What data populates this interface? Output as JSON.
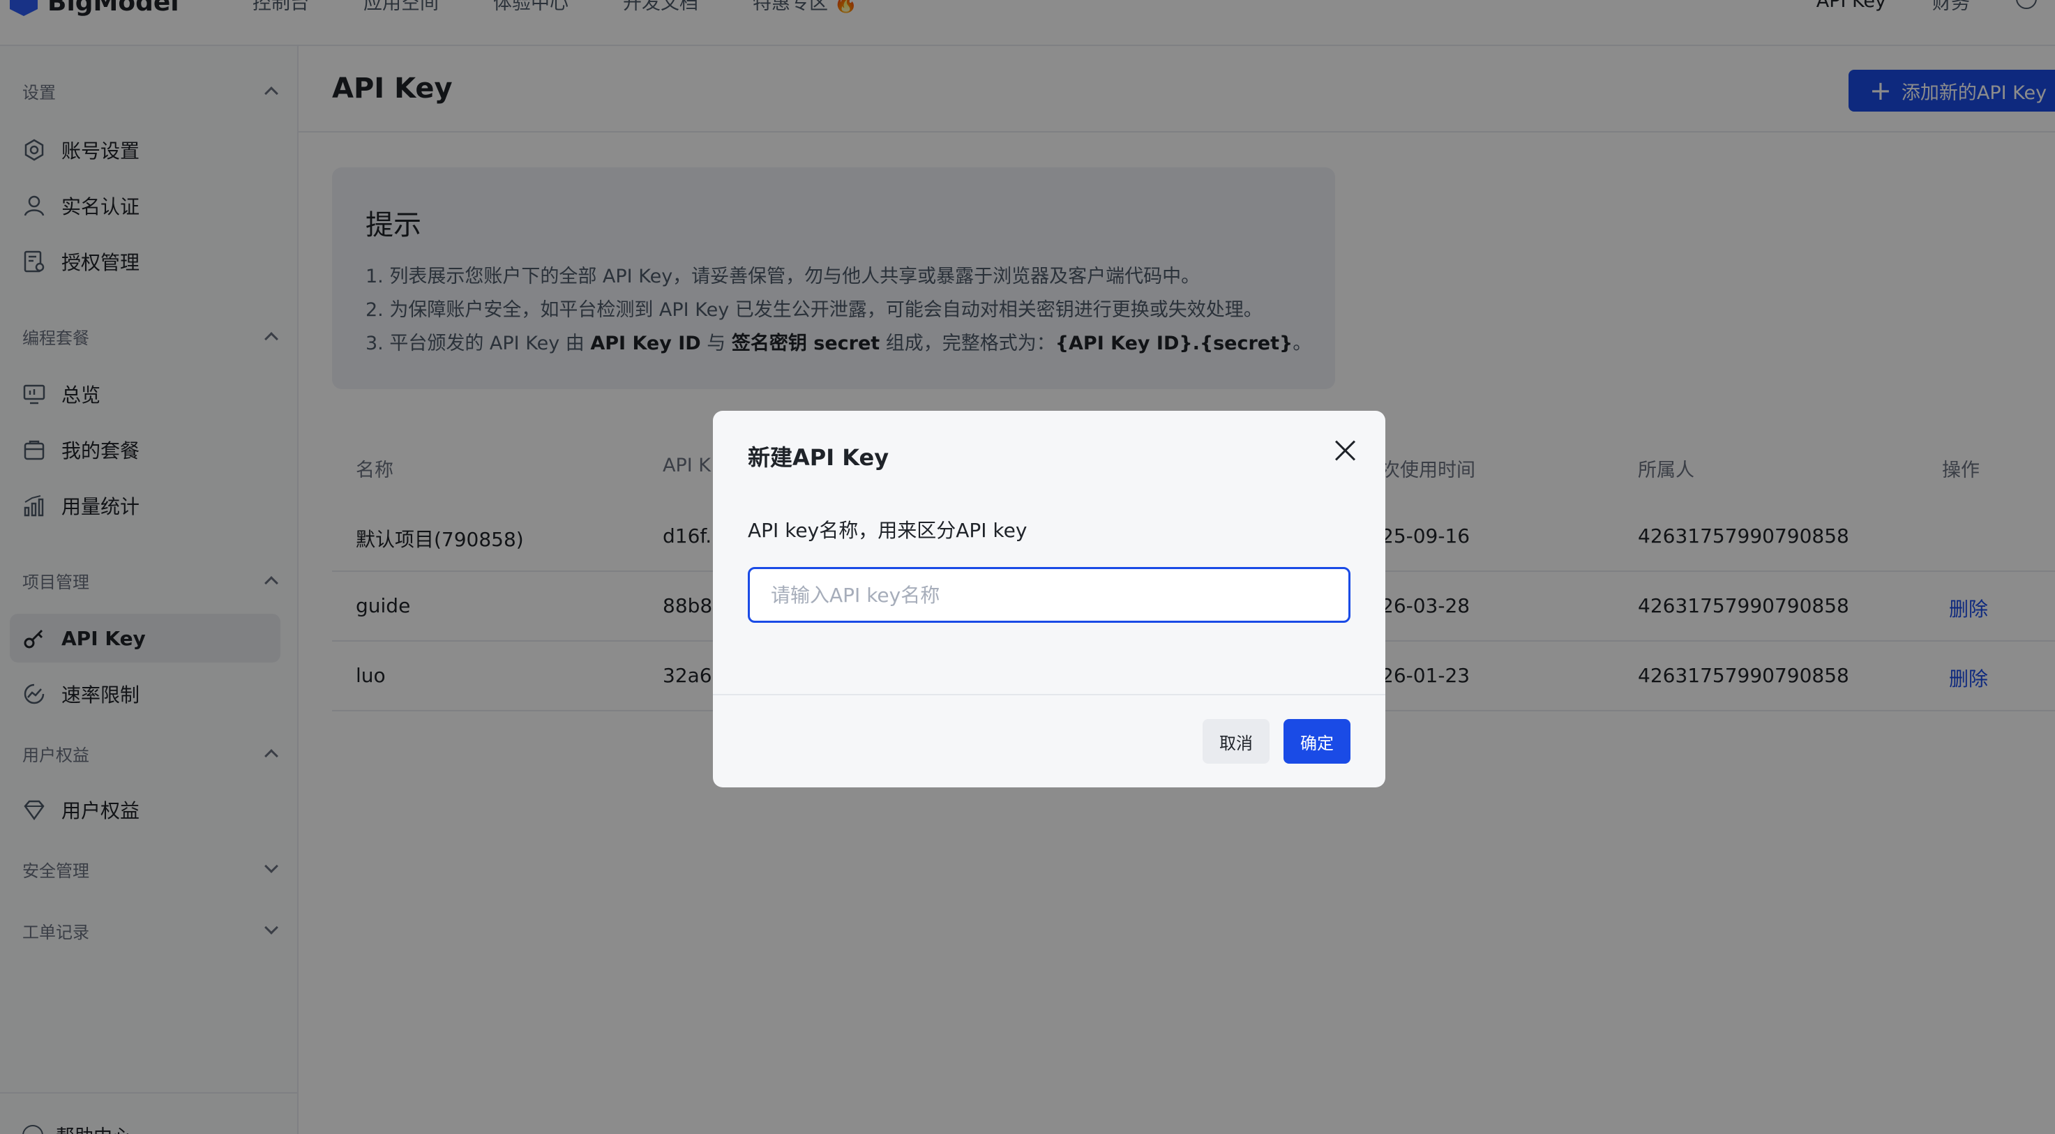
{
  "brand": {
    "name": "BigModel"
  },
  "topnav": {
    "items": [
      "控制台",
      "应用空间",
      "体验中心",
      "开发文档",
      "特惠专区 🔥"
    ],
    "right_api_key": "API Key",
    "right_finance": "财务"
  },
  "sidebar": {
    "groups": [
      {
        "label": "设置",
        "items": [
          "账号设置",
          "实名认证",
          "授权管理"
        ]
      },
      {
        "label": "编程套餐",
        "items": [
          "总览",
          "我的套餐",
          "用量统计"
        ]
      },
      {
        "label": "项目管理",
        "items": [
          "API Key",
          "速率限制"
        ]
      },
      {
        "label": "用户权益",
        "items": [
          "用户权益"
        ]
      },
      {
        "label": "安全管理",
        "items": []
      },
      {
        "label": "工单记录",
        "items": []
      }
    ],
    "active_item": "API Key",
    "help": "帮助中心"
  },
  "page": {
    "title": "API Key",
    "add_button": "添加新的API Key"
  },
  "tip": {
    "title": "提示",
    "line1": "1. 列表展示您账户下的全部 API Key，请妥善保管，勿与他人共享或暴露于浏览器及客户端代码中。",
    "line2": "2. 为保障账户安全，如平台检测到 API Key 已发生公开泄露，可能会自动对相关密钥进行更换或失效处理。",
    "line3_a": "3. 平台颁发的 API Key 由 ",
    "line3_b": "API Key ID",
    "line3_c": " 与 ",
    "line3_d": "签名密钥 secret",
    "line3_e": " 组成，完整格式为：",
    "line3_f": "{API Key ID}.{secret}",
    "line3_g": "。"
  },
  "table": {
    "headers": [
      "名称",
      "API K",
      "次使用时间",
      "所属人",
      "操作"
    ],
    "rows": [
      {
        "name": "默认项目(790858)",
        "key": "d16f..",
        "last_used": "25-09-16",
        "owner": "42631757990790858",
        "action": ""
      },
      {
        "name": "guide",
        "key": "88b8..",
        "last_used": "26-03-28",
        "owner": "42631757990790858",
        "action": "删除"
      },
      {
        "name": "luo",
        "key": "32a6..",
        "last_used": "26-01-23",
        "owner": "42631757990790858",
        "action": "删除"
      }
    ]
  },
  "modal": {
    "title": "新建API Key",
    "field_label": "API key名称，用来区分API key",
    "placeholder": "请输入API key名称",
    "value": "",
    "cancel": "取消",
    "confirm": "确定"
  },
  "colors": {
    "primary": "#1a4be6",
    "mask": "rgba(0,0,0,0.45)"
  }
}
